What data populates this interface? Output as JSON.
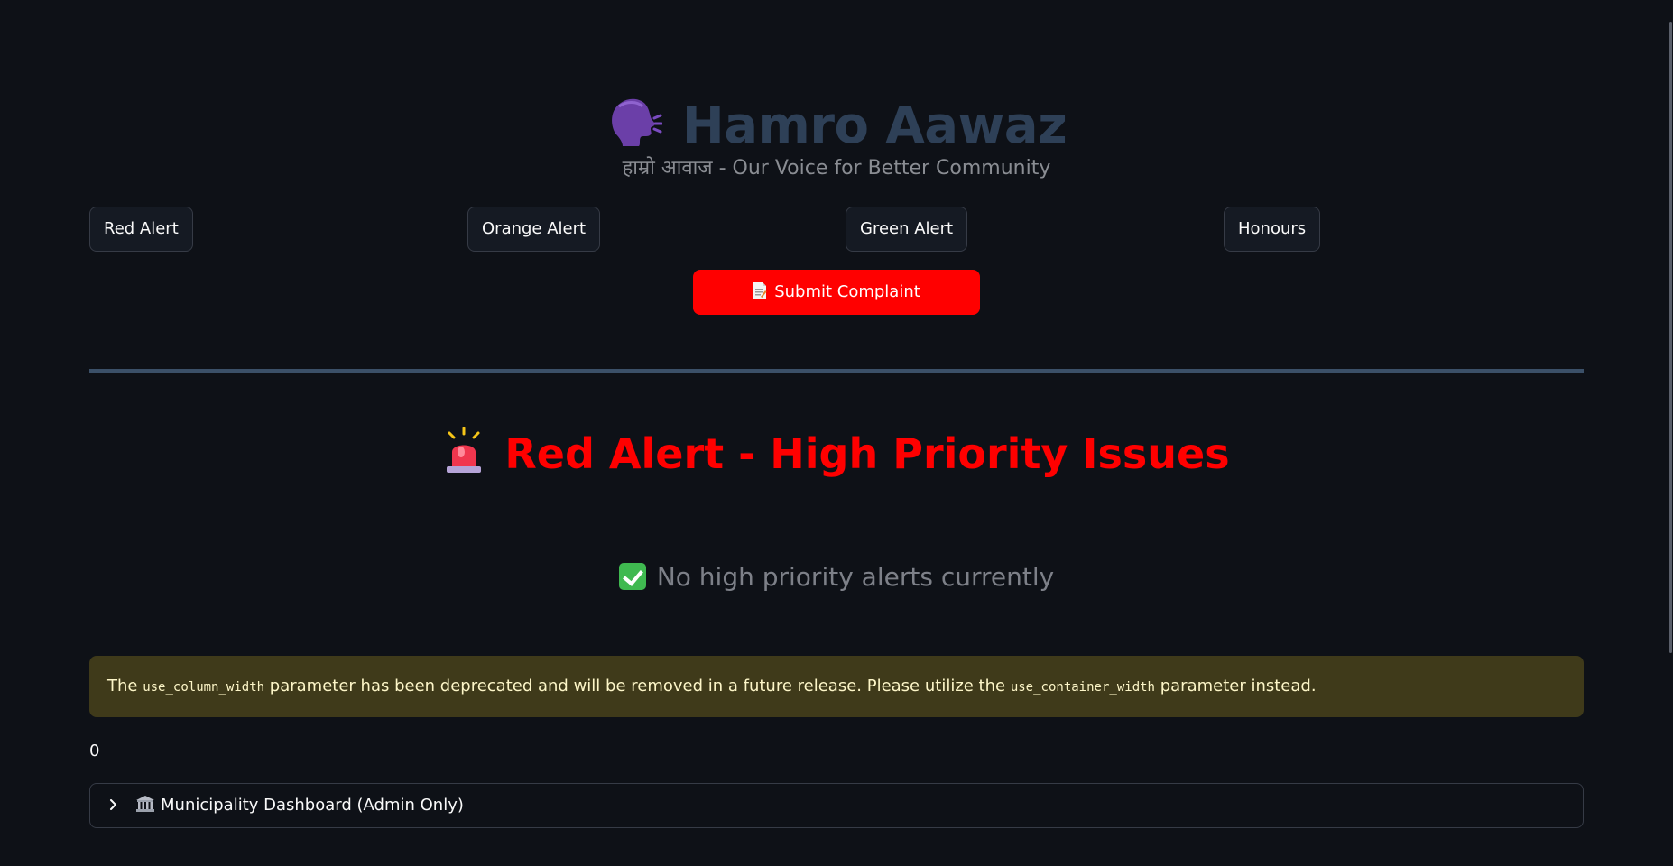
{
  "app": {
    "title": "Hamro Aawaz",
    "subtitle": "हाम्रो आवाज - Our Voice for Better Community",
    "title_icon": "speaking-head-icon"
  },
  "nav": {
    "buttons": [
      {
        "label": "Red Alert"
      },
      {
        "label": "Orange Alert"
      },
      {
        "label": "Green Alert"
      },
      {
        "label": "Honours"
      }
    ]
  },
  "submit": {
    "label": "Submit Complaint",
    "icon": "document-icon",
    "color": "#ff0000"
  },
  "section": {
    "title": "Red Alert - High Priority Issues",
    "icon": "siren-icon",
    "color": "#ff0000"
  },
  "status": {
    "text": "No high priority alerts currently",
    "icon": "check-mark-icon"
  },
  "warning": {
    "text_1": "The ",
    "code_1": "use_column_width",
    "text_2": " parameter has been deprecated and will be removed in a future release. Please utilize the ",
    "code_2": "use_container_width",
    "text_3": " parameter instead."
  },
  "counter": {
    "value": "0"
  },
  "expander": {
    "label": "Municipality Dashboard (Admin Only)",
    "icon": "classical-building-icon"
  },
  "colors": {
    "background": "#0e1117",
    "title_color": "#2e4057",
    "divider": "#3b5068",
    "warning_bg": "#3f3a1a"
  }
}
